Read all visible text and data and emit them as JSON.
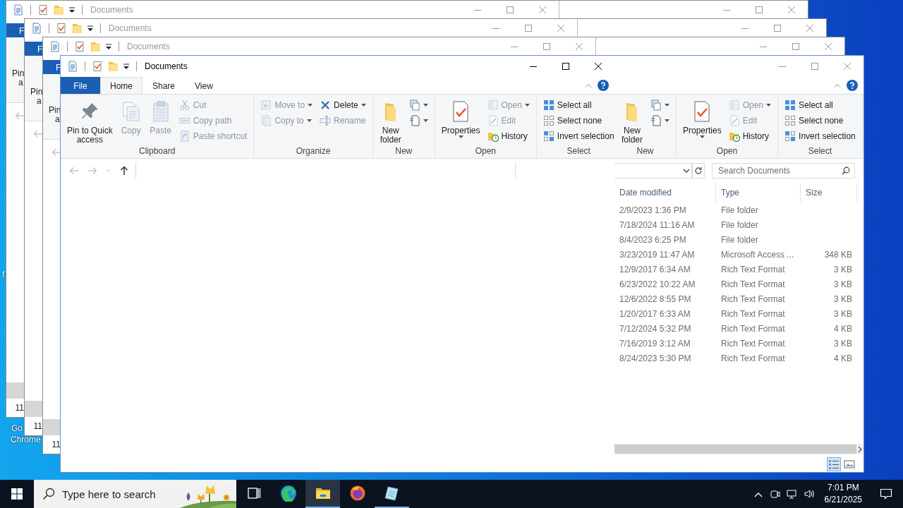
{
  "desktop_labels": [
    {
      "label": "f"
    },
    {
      "label": "Go"
    },
    {
      "label": "Chrome"
    }
  ],
  "back_windows": [
    {
      "title": "Documents",
      "file_tab": "F",
      "pin_label": "Pin",
      "pin_label_cont": "a",
      "row_text": "11"
    },
    {
      "title": "Documents",
      "file_tab": "F",
      "pin_label": "Pin",
      "pin_label_cont": "a",
      "row_text": "11"
    },
    {
      "title": "Documents",
      "file_tab": "F",
      "pin_label": "Pin",
      "pin_label_cont": "a",
      "row_text": "11"
    }
  ],
  "front_window": {
    "panes": [
      {
        "active": true,
        "title": "Documents",
        "tabs": [
          {
            "label": "File",
            "kind": "file",
            "selected": false
          },
          {
            "label": "Home",
            "kind": "tab",
            "selected": true
          },
          {
            "label": "Share",
            "kind": "tab",
            "selected": false
          },
          {
            "label": "View",
            "kind": "tab",
            "selected": false
          }
        ],
        "ribbon_groups": [
          {
            "label": "Clipboard",
            "columns": [
              [
                {
                  "kind": "pin",
                  "label": "Pin to Quick\naccess",
                  "disabled": false,
                  "dropdown": false
                }
              ],
              [
                {
                  "kind": "copy",
                  "label": "Copy",
                  "disabled": true,
                  "dropdown": false
                }
              ],
              [
                {
                  "kind": "paste",
                  "label": "Paste",
                  "disabled": true,
                  "dropdown": false
                }
              ],
              [
                {
                  "kind": "cut",
                  "label": "Cut",
                  "disabled": true,
                  "dropdown": false
                },
                {
                  "kind": "copypath",
                  "label": "Copy path",
                  "disabled": true,
                  "dropdown": false
                },
                {
                  "kind": "pasteshortcut",
                  "label": "Paste shortcut",
                  "disabled": true,
                  "dropdown": false
                }
              ]
            ]
          },
          {
            "label": "Organize",
            "columns": [
              [
                {
                  "kind": "moveto",
                  "label": "Move to",
                  "disabled": true,
                  "dropdown": true
                },
                {
                  "kind": "copyto",
                  "label": "Copy to",
                  "disabled": true,
                  "dropdown": true
                }
              ],
              [
                {
                  "kind": "delete",
                  "label": "Delete",
                  "disabled": false,
                  "dropdown": true
                },
                {
                  "kind": "rename",
                  "label": "Rename",
                  "disabled": true,
                  "dropdown": false
                }
              ]
            ]
          },
          {
            "label": "New",
            "columns": [
              [
                {
                  "kind": "newfolder",
                  "label": "New\nfolder",
                  "disabled": false,
                  "dropdown": false
                }
              ],
              [
                {
                  "kind": "newitem",
                  "disabled": false,
                  "dropdown": true
                },
                {
                  "kind": "easyaccess",
                  "disabled": false,
                  "dropdown": true
                }
              ]
            ]
          },
          {
            "label": "Open",
            "columns": [
              [
                {
                  "kind": "properties",
                  "label": "Properties",
                  "disabled": false,
                  "dropdown": true
                }
              ],
              [
                {
                  "kind": "open",
                  "label": "Open",
                  "disabled": true,
                  "dropdown": true
                },
                {
                  "kind": "edit",
                  "label": "Edit",
                  "disabled": true,
                  "dropdown": false
                },
                {
                  "kind": "history",
                  "label": "History",
                  "disabled": false,
                  "dropdown": false
                }
              ]
            ]
          },
          {
            "label": "Select",
            "columns": [
              [
                {
                  "kind": "selectall",
                  "label": "Select all",
                  "disabled": false,
                  "dropdown": false
                },
                {
                  "kind": "selectnone",
                  "label": "Select none",
                  "disabled": false,
                  "dropdown": false
                },
                {
                  "kind": "invert",
                  "label": "Invert selection",
                  "disabled": false,
                  "dropdown": false
                }
              ]
            ]
          }
        ],
        "nav_buttons": [
          {
            "kind": "back",
            "disabled": true
          },
          {
            "kind": "forward",
            "disabled": true
          },
          {
            "kind": "recent",
            "disabled": true
          },
          {
            "kind": "up",
            "disabled": false
          }
        ]
      },
      {
        "active": false,
        "ribbon_groups": [
          {
            "label": "New",
            "columns": [
              [
                {
                  "kind": "newfolder",
                  "label": "New\nfolder",
                  "disabled": false,
                  "dropdown": false
                }
              ],
              [
                {
                  "kind": "newitem",
                  "disabled": false,
                  "dropdown": true
                },
                {
                  "kind": "easyaccess",
                  "disabled": false,
                  "dropdown": true
                }
              ]
            ]
          },
          {
            "label": "Open",
            "columns": [
              [
                {
                  "kind": "properties",
                  "label": "Properties",
                  "disabled": false,
                  "dropdown": true
                }
              ],
              [
                {
                  "kind": "open",
                  "label": "Open",
                  "disabled": true,
                  "dropdown": true
                },
                {
                  "kind": "edit",
                  "label": "Edit",
                  "disabled": true,
                  "dropdown": false
                },
                {
                  "kind": "history",
                  "label": "History",
                  "disabled": false,
                  "dropdown": false
                }
              ]
            ]
          },
          {
            "label": "Select",
            "columns": [
              [
                {
                  "kind": "selectall",
                  "label": "Select all",
                  "disabled": false,
                  "dropdown": false
                },
                {
                  "kind": "selectnone",
                  "label": "Select none",
                  "disabled": false,
                  "dropdown": false
                },
                {
                  "kind": "invert",
                  "label": "Invert selection",
                  "disabled": false,
                  "dropdown": false
                }
              ]
            ]
          }
        ],
        "search": {
          "placeholder": "Search Documents"
        },
        "columns": [
          {
            "label": "Date modified"
          },
          {
            "label": "Type"
          },
          {
            "label": "Size"
          }
        ],
        "rows": [
          {
            "date": "2/9/2023 1:36 PM",
            "type": "File folder"
          },
          {
            "date": "7/18/2024 11:16 AM",
            "type": "File folder"
          },
          {
            "date": "8/4/2023 6:25 PM",
            "type": "File folder"
          },
          {
            "date": "3/23/2019 11:47 AM",
            "type": "Microsoft Access ...",
            "size": "348 KB"
          },
          {
            "date": "12/9/2017 6:34 AM",
            "type": "Rich Text Format",
            "size": "3 KB"
          },
          {
            "date": "6/23/2022 10:22 AM",
            "type": "Rich Text Format",
            "size": "3 KB"
          },
          {
            "date": "12/6/2022 8:55 PM",
            "type": "Rich Text Format",
            "size": "3 KB"
          },
          {
            "date": "1/20/2017 6:33 AM",
            "type": "Rich Text Format",
            "size": "3 KB"
          },
          {
            "date": "7/12/2024 5:32 PM",
            "type": "Rich Text Format",
            "size": "4 KB"
          },
          {
            "date": "7/16/2019 3:12 AM",
            "type": "Rich Text Format",
            "size": "3 KB"
          },
          {
            "date": "8/24/2023 5:30 PM",
            "type": "Rich Text Format",
            "size": "4 KB"
          }
        ],
        "views": [
          {
            "kind": "details",
            "selected": true
          },
          {
            "kind": "tiles",
            "selected": false
          }
        ]
      }
    ]
  },
  "taskbar": {
    "search": {
      "placeholder": "Type here to search"
    },
    "apps": [
      {
        "kind": "taskview",
        "active": false,
        "running": false
      },
      {
        "kind": "edge",
        "active": false,
        "running": false
      },
      {
        "kind": "explorer",
        "active": true,
        "running": true
      },
      {
        "kind": "firefox",
        "active": false,
        "running": false
      },
      {
        "kind": "notepad",
        "active": false,
        "running": true
      }
    ],
    "time": "7:01 PM",
    "date": "6/21/2025"
  }
}
